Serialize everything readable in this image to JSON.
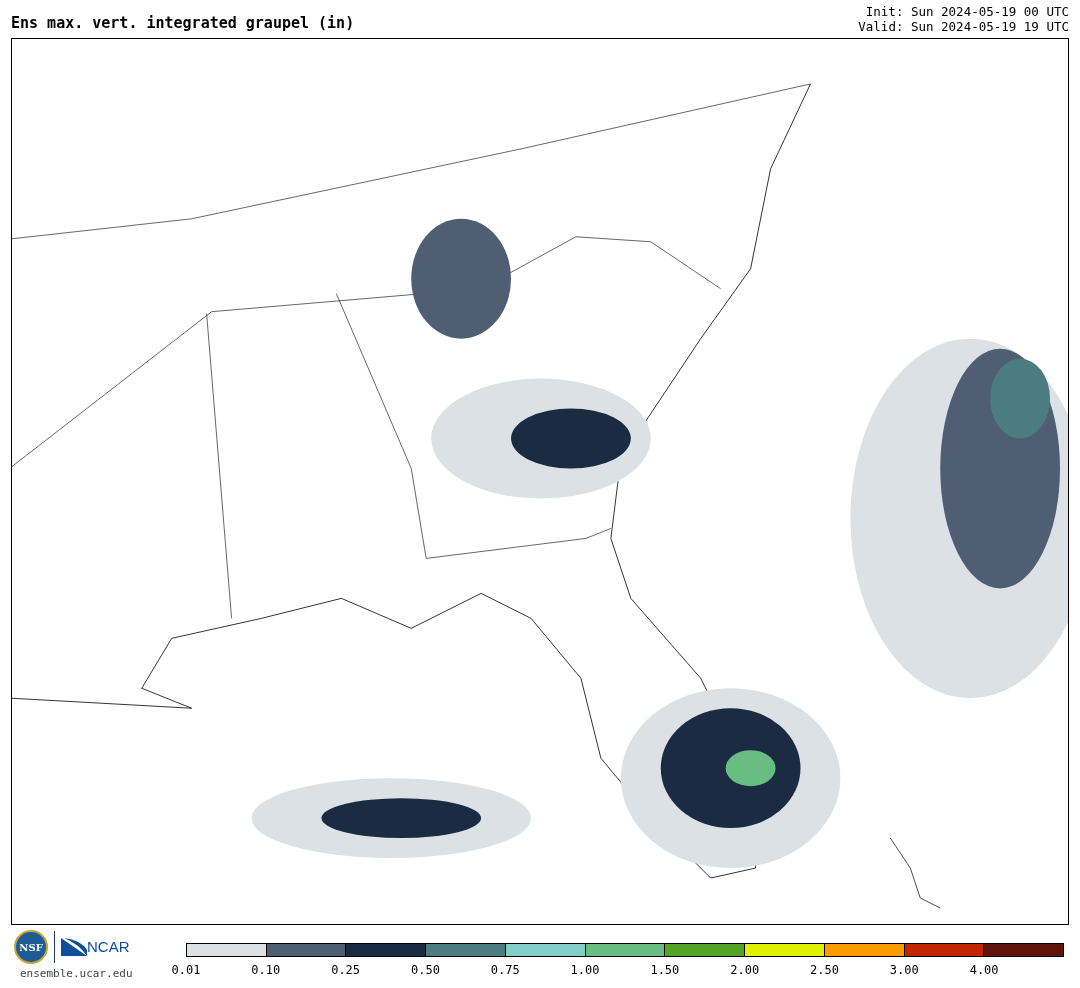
{
  "title": "Ens max. vert. integrated graupel (in)",
  "init": "Init: Sun 2024-05-19 00 UTC",
  "valid": "Valid: Sun 2024-05-19 19 UTC",
  "logos": {
    "nsf": "NSF",
    "ncar": "NCAR",
    "site": "ensemble.ucar.edu"
  },
  "colorbar": [
    {
      "label": "0.01",
      "color": "#dce1e5"
    },
    {
      "label": "0.10",
      "color": "#4f5e72"
    },
    {
      "label": "0.25",
      "color": "#1a2b42"
    },
    {
      "label": "0.50",
      "color": "#4b7c82"
    },
    {
      "label": "0.75",
      "color": "#82cfc8"
    },
    {
      "label": "1.00",
      "color": "#68bd82"
    },
    {
      "label": "1.50",
      "color": "#53a325"
    },
    {
      "label": "2.00",
      "color": "#e1f000"
    },
    {
      "label": "2.50",
      "color": "#fb9c00"
    },
    {
      "label": "3.00",
      "color": "#c22500"
    },
    {
      "label": "4.00",
      "color": "#5e160c"
    }
  ]
}
